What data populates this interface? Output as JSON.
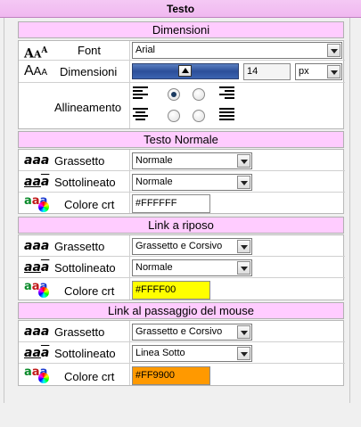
{
  "window": {
    "title": "Testo"
  },
  "dimensioni": {
    "header": "Dimensioni",
    "font": {
      "label": "Font",
      "value": "Arial"
    },
    "size": {
      "label": "Dimensioni",
      "value": "14",
      "unit": "px"
    },
    "align": {
      "label": "Allineamento"
    }
  },
  "icons": {
    "aaa": "aaa",
    "aaa_ul": "aa",
    "aaa_ol": "a",
    "crt": "aaa"
  },
  "sections": [
    {
      "header": "Testo Normale",
      "bold": {
        "label": "Grassetto",
        "value": "Normale"
      },
      "underline": {
        "label": "Sottolineato",
        "value": "Normale"
      },
      "color": {
        "label": "Colore crt",
        "value": "#FFFFFF",
        "swatch": "#ffffff"
      }
    },
    {
      "header": "Link a riposo",
      "bold": {
        "label": "Grassetto",
        "value": "Grassetto e Corsivo"
      },
      "underline": {
        "label": "Sottolineato",
        "value": "Normale"
      },
      "color": {
        "label": "Colore crt",
        "value": "#FFFF00",
        "swatch": "#ffff00"
      }
    },
    {
      "header": "Link al passaggio del mouse",
      "bold": {
        "label": "Grassetto",
        "value": "Grassetto e Corsivo"
      },
      "underline": {
        "label": "Sottolineato",
        "value": "Linea Sotto"
      },
      "color": {
        "label": "Colore crt",
        "value": "#FF9900",
        "swatch": "#ff9900"
      }
    }
  ]
}
